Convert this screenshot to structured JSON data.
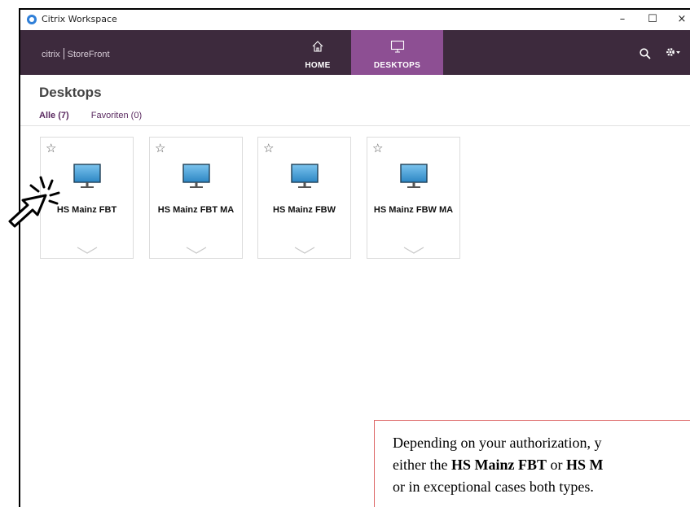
{
  "window": {
    "title": "Citrix Workspace",
    "controls": {
      "minimize": "–",
      "maximize": "☐",
      "close": "×"
    }
  },
  "header": {
    "brand": "citrix",
    "product": "StoreFront",
    "nav": [
      {
        "label": "HOME",
        "icon": "home-icon",
        "active": false
      },
      {
        "label": "DESKTOPS",
        "icon": "desktop-icon",
        "active": true
      }
    ],
    "colors": {
      "bar": "#3d2a3d",
      "active_tab": "#8d4f93"
    }
  },
  "page": {
    "title": "Desktops",
    "tabs": [
      {
        "label": "Alle (7)",
        "active": true
      },
      {
        "label": "Favoriten (0)",
        "active": false
      }
    ]
  },
  "desktops": [
    {
      "name": "HS Mainz FBT"
    },
    {
      "name": "HS Mainz FBT MA"
    },
    {
      "name": "HS Mainz FBW"
    },
    {
      "name": "HS Mainz FBW MA"
    }
  ],
  "note": {
    "line1": "Depending on your authorization, y",
    "line2_pre": "either the ",
    "line2_bold1": "HS Mainz FBT",
    "line2_mid": " or ",
    "line2_bold2": "HS M",
    "line3": "or in exceptional cases both types."
  }
}
